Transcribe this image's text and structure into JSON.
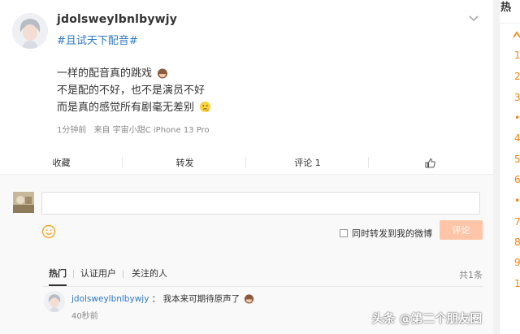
{
  "post": {
    "username": "jdolsweylbnlbywjy",
    "topic": "#且试天下配音#",
    "lines": [
      "一样的配音真的跳戏",
      "不是配的不好，也不是演员不好",
      "而是真的感觉所有剧毫无差别"
    ],
    "time": "1分钟前",
    "source": "来自 宇宙小甜C iPhone 13 Pro"
  },
  "actions": {
    "favorite": "收藏",
    "repost": "转发",
    "comment": "评论 1"
  },
  "comment_box": {
    "placeholder": "",
    "sync_label": "同时转发到我的微博",
    "submit": "评论"
  },
  "filters": {
    "hot": "热门",
    "verified": "认证用户",
    "following": "关注的人",
    "count": "共1条"
  },
  "comment": {
    "user": "jdolsweylbnlbywjy",
    "sep": "：",
    "text": "我本来可期待原声了",
    "time": "40秒前"
  },
  "watermark": "头条 @第二个朋友圈",
  "sidebar": {
    "title": "热",
    "ranks": [
      "1",
      "2",
      "3",
      "•",
      "4",
      "5",
      "6",
      "•",
      "7",
      "8",
      "9",
      "1"
    ]
  },
  "colors": {
    "link": "#2f79c6",
    "accent": "#ff8200",
    "submit_disabled": "#ffc5a8"
  }
}
